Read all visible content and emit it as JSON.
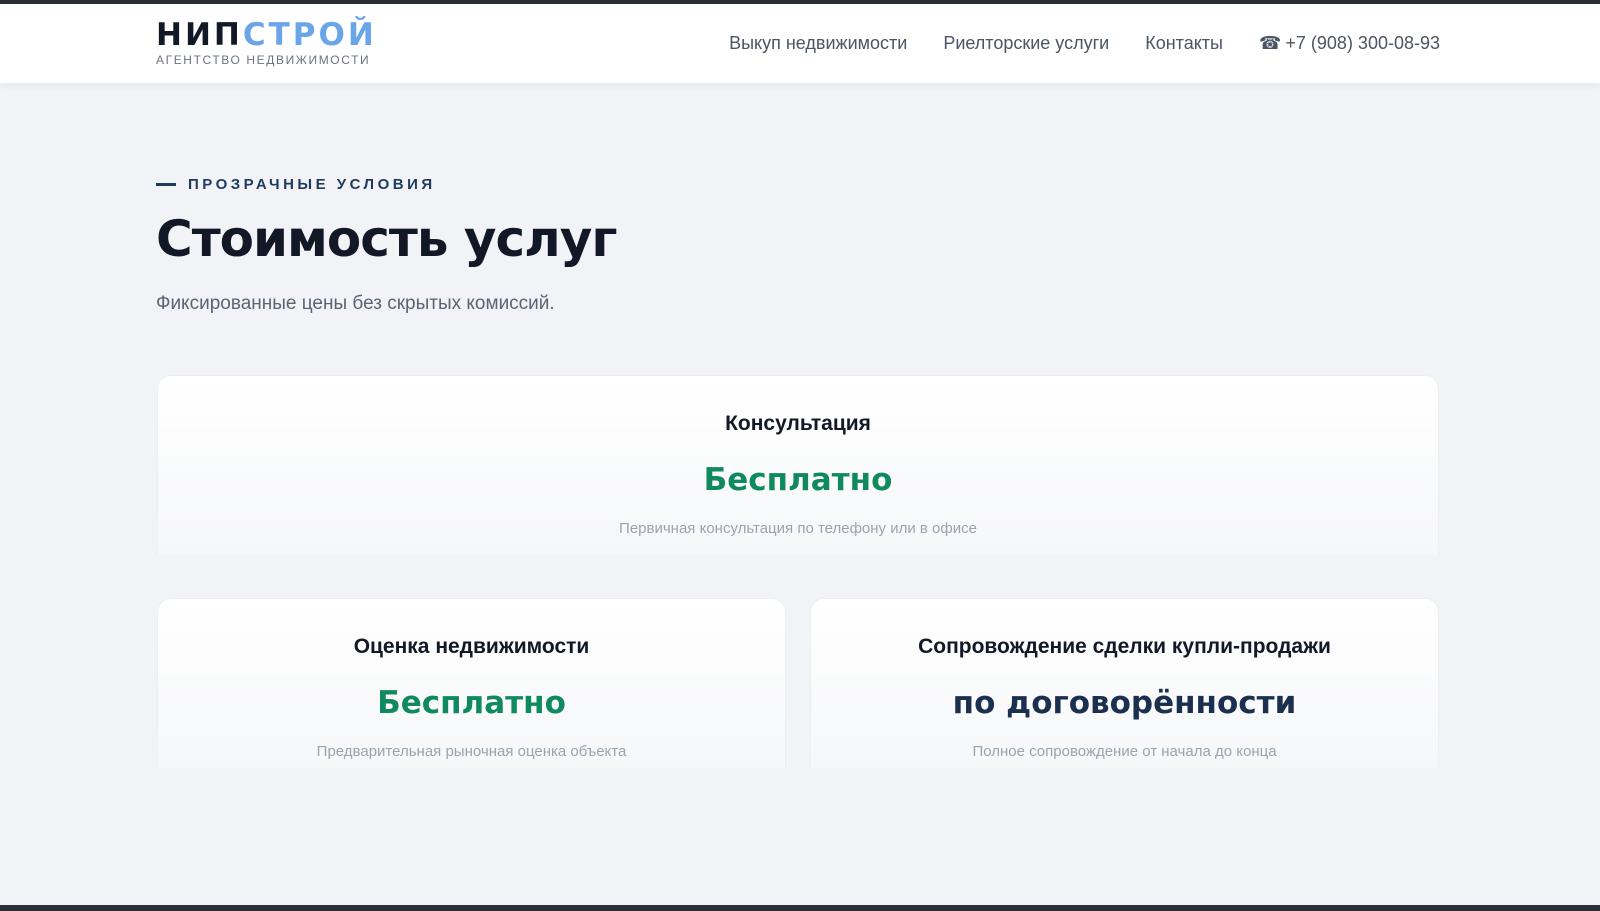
{
  "header": {
    "logo": {
      "part1": "НИП",
      "part2": "СТРОЙ",
      "tagline": "АГЕНТСТВО НЕДВИЖИМОСТИ"
    },
    "nav": [
      {
        "label": "Выкуп недвижимости"
      },
      {
        "label": "Риелторские услуги"
      },
      {
        "label": "Контакты"
      }
    ],
    "phone": {
      "icon": "☎",
      "number": "+7 (908) 300-08-93"
    }
  },
  "section": {
    "eyebrow": "ПРОЗРАЧНЫЕ УСЛОВИЯ",
    "title": "Стоимость услуг",
    "subtitle": "Фиксированные цены без скрытых комиссий."
  },
  "cards": [
    {
      "title": "Консультация",
      "price": "Бесплатно",
      "price_color": "#0f8a5f",
      "description": "Первичная консультация по телефону или в офисе"
    },
    {
      "title": "Оценка недвижимости",
      "price": "Бесплатно",
      "price_color": "#0f8a5f",
      "description": "Предварительная рыночная оценка объекта"
    },
    {
      "title": "Сопровождение сделки купли-продажи",
      "price": "по договорённости",
      "price_color": "#1b2f4f",
      "description": "Полное сопровождение от начала до конца"
    }
  ]
}
